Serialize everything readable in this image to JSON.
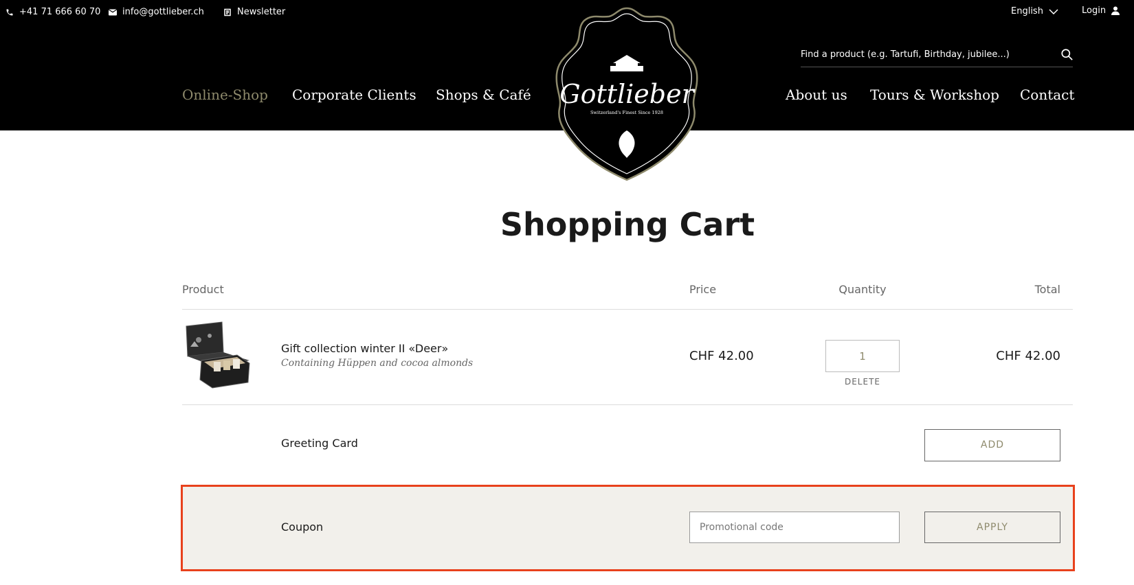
{
  "header": {
    "phone": "+41 71 666 60 70",
    "email": "info@gottlieber.ch",
    "newsletter": "Newsletter",
    "language": "English",
    "login": "Login",
    "search_placeholder": "Find a product (e.g. Tartufi, Birthday, jubilee...)",
    "nav_left": [
      "Online-Shop",
      "Corporate Clients",
      "Shops & Café"
    ],
    "nav_right": [
      "About us",
      "Tours & Workshop",
      "Contact"
    ],
    "logo_name": "Gottlieber",
    "logo_tagline": "Switzerland's Finest Since 1928"
  },
  "page_title": "Shopping Cart",
  "table": {
    "headers": {
      "product": "Product",
      "price": "Price",
      "quantity": "Quantity",
      "total": "Total"
    }
  },
  "item": {
    "name": "Gift collection winter II «Deer»",
    "subtitle": "Containing Hüppen and cocoa almonds",
    "price": "CHF 42.00",
    "quantity": "1",
    "delete_label": "DELETE",
    "total": "CHF 42.00"
  },
  "greeting_card": {
    "label": "Greeting Card",
    "button": "ADD"
  },
  "coupon": {
    "label": "Coupon",
    "placeholder": "Promotional code",
    "button": "APPLY"
  },
  "colors": {
    "accent": "#8e8a6c",
    "highlight_border": "#e8411c",
    "coupon_bg": "#f2f0eb",
    "header_bg": "#000000"
  }
}
